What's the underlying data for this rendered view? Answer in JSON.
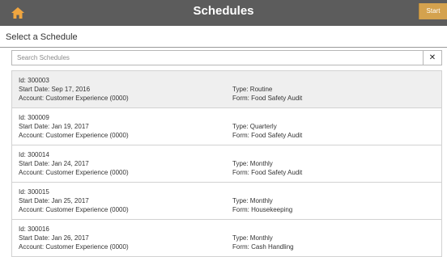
{
  "header": {
    "title": "Schedules",
    "start_label": "Start",
    "home_icon": "home-icon"
  },
  "subheader": {
    "title": "Select a Schedule"
  },
  "search": {
    "placeholder": "Search Schedules",
    "value": "",
    "clear_label": "✕"
  },
  "colors": {
    "topbar": "#5c5c5c",
    "accent": "#d4a24e",
    "selected_row": "#efefef"
  },
  "schedules": [
    {
      "id": "Id: 300003",
      "start_date": "Start Date: Sep 17, 2016",
      "account": "Account: Customer Experience (0000)",
      "type": "Type: Routine",
      "form": "Form: Food Safety Audit",
      "selected": true
    },
    {
      "id": "Id: 300009",
      "start_date": "Start Date: Jan 19, 2017",
      "account": "Account: Customer Experience (0000)",
      "type": "Type: Quarterly",
      "form": "Form: Food Safety Audit",
      "selected": false
    },
    {
      "id": "Id: 300014",
      "start_date": "Start Date: Jan 24, 2017",
      "account": "Account: Customer Experience (0000)",
      "type": "Type: Monthly",
      "form": "Form: Food Safety Audit",
      "selected": false
    },
    {
      "id": "Id: 300015",
      "start_date": "Start Date: Jan 25, 2017",
      "account": "Account: Customer Experience (0000)",
      "type": "Type: Monthly",
      "form": "Form: Housekeeping",
      "selected": false
    },
    {
      "id": "Id: 300016",
      "start_date": "Start Date: Jan 26, 2017",
      "account": "Account: Customer Experience (0000)",
      "type": "Type: Monthly",
      "form": "Form: Cash Handling",
      "selected": false
    }
  ]
}
